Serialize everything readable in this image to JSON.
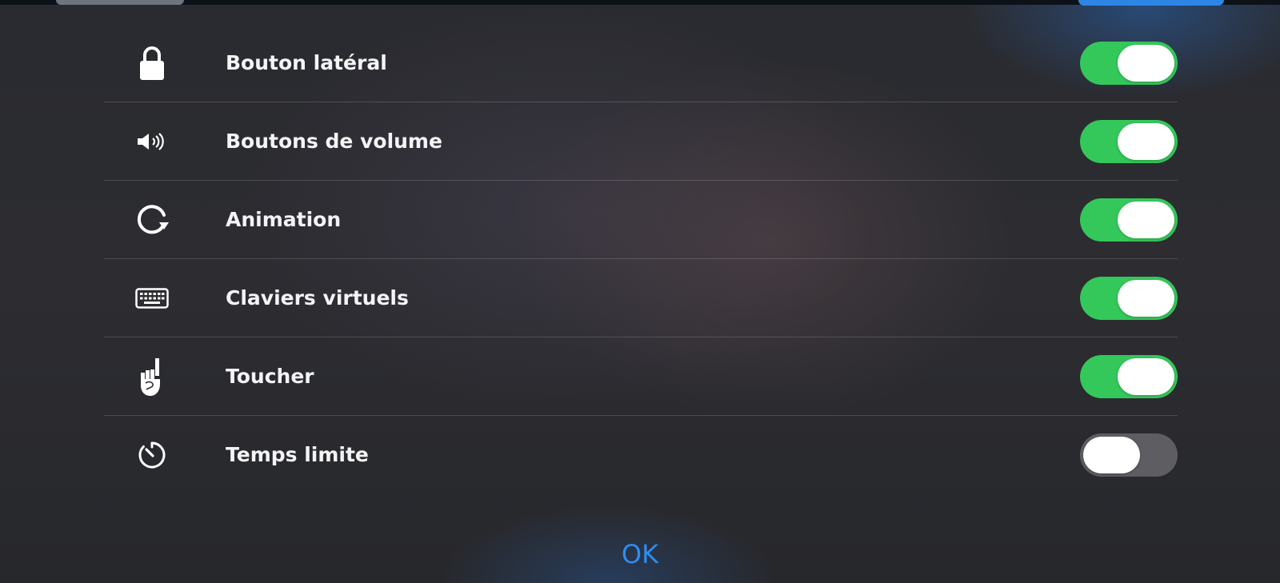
{
  "settings": {
    "items": [
      {
        "label": "Bouton latéral",
        "icon": "lock-icon",
        "enabled": true
      },
      {
        "label": "Boutons de volume",
        "icon": "speaker-volume-icon",
        "enabled": true
      },
      {
        "label": "Animation",
        "icon": "rotate-arrow-icon",
        "enabled": true
      },
      {
        "label": "Claviers virtuels",
        "icon": "keyboard-icon",
        "enabled": true
      },
      {
        "label": "Toucher",
        "icon": "pointing-hand-icon",
        "enabled": true
      },
      {
        "label": "Temps limite",
        "icon": "timer-icon",
        "enabled": false
      }
    ]
  },
  "footer": {
    "ok_label": "OK"
  },
  "colors": {
    "toggle_on": "#34c85a",
    "toggle_off": "#5d5d62",
    "accent": "#2f8cf0"
  }
}
